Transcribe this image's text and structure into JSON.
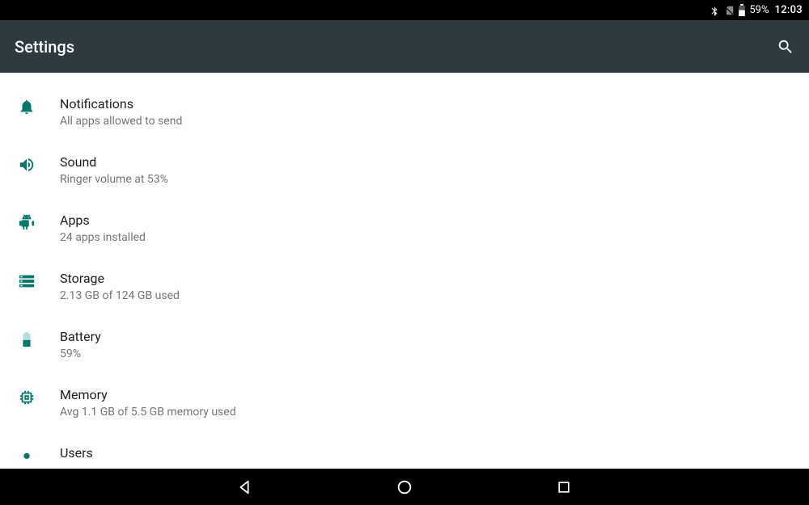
{
  "status_bar": {
    "battery_pct": "59%",
    "clock": "12:03"
  },
  "app_bar": {
    "title": "Settings"
  },
  "settings_items": [
    {
      "id": "notifications",
      "icon": "bell",
      "title": "Notifications",
      "subtitle": "All apps allowed to send"
    },
    {
      "id": "sound",
      "icon": "volume",
      "title": "Sound",
      "subtitle": "Ringer volume at 53%"
    },
    {
      "id": "apps",
      "icon": "android",
      "title": "Apps",
      "subtitle": "24 apps installed"
    },
    {
      "id": "storage",
      "icon": "storage",
      "title": "Storage",
      "subtitle": "2.13 GB of 124 GB used"
    },
    {
      "id": "battery",
      "icon": "battery",
      "title": "Battery",
      "subtitle": "59%"
    },
    {
      "id": "memory",
      "icon": "memory",
      "title": "Memory",
      "subtitle": "Avg 1.1 GB of 5.5 GB memory used"
    },
    {
      "id": "users",
      "icon": "user",
      "title": "Users",
      "subtitle": ""
    }
  ],
  "colors": {
    "accent": "#00796b",
    "appbar": "#2d3b41"
  }
}
